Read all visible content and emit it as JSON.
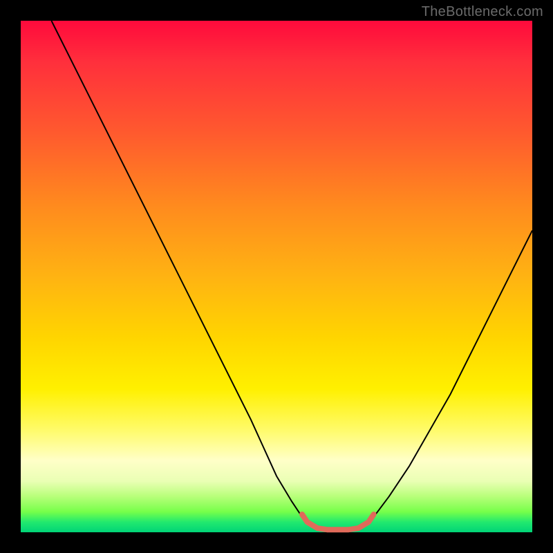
{
  "watermark": "TheBottleneck.com",
  "chart_data": {
    "type": "line",
    "title": "",
    "xlabel": "",
    "ylabel": "",
    "xlim": [
      0,
      100
    ],
    "ylim": [
      0,
      100
    ],
    "grid": false,
    "legend": false,
    "annotations": [],
    "series": [
      {
        "name": "left-curve",
        "stroke": "#000000",
        "stroke_width": 2,
        "x": [
          6,
          10,
          15,
          20,
          25,
          30,
          35,
          40,
          45,
          50,
          53,
          55,
          57
        ],
        "y": [
          100,
          92,
          82,
          72,
          62,
          52,
          42,
          32,
          22,
          11,
          6,
          3,
          1
        ]
      },
      {
        "name": "right-curve",
        "stroke": "#000000",
        "stroke_width": 2,
        "x": [
          67,
          69,
          72,
          76,
          80,
          84,
          88,
          92,
          96,
          100
        ],
        "y": [
          1,
          3,
          7,
          13,
          20,
          27,
          35,
          43,
          51,
          59
        ]
      },
      {
        "name": "trough-highlight",
        "stroke": "#e06a5a",
        "stroke_width": 8,
        "linecap": "round",
        "x": [
          55,
          56,
          58,
          60,
          62,
          64,
          66,
          68,
          69
        ],
        "y": [
          3.5,
          2,
          0.8,
          0.5,
          0.5,
          0.5,
          0.8,
          2,
          3.5
        ]
      }
    ],
    "background_gradient": {
      "direction": "top-to-bottom",
      "stops": [
        {
          "pos": 0,
          "color": "#ff0a3c"
        },
        {
          "pos": 22,
          "color": "#ff5a2e"
        },
        {
          "pos": 50,
          "color": "#ffb312"
        },
        {
          "pos": 72,
          "color": "#fff000"
        },
        {
          "pos": 86,
          "color": "#ffffc8"
        },
        {
          "pos": 96,
          "color": "#76ff4a"
        },
        {
          "pos": 100,
          "color": "#00d477"
        }
      ]
    }
  }
}
